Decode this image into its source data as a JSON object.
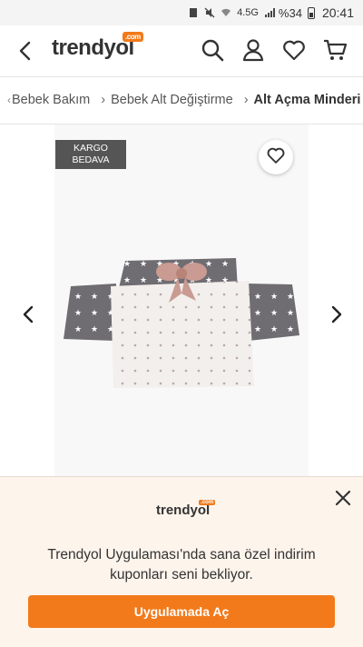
{
  "status_bar": {
    "network": "4.5G",
    "battery": "%34",
    "time": "20:41"
  },
  "header": {
    "logo_text": "trendyol",
    "logo_badge": ".com"
  },
  "breadcrumb": {
    "items": [
      "Bebek Bakım",
      "Bebek Alt Değiştirme",
      "Alt Açma Minderi"
    ]
  },
  "gallery": {
    "badge_line1": "KARGO",
    "badge_line2": "BEDAVA"
  },
  "app_banner": {
    "logo_text": "trendyol",
    "logo_badge": ".com",
    "message": "Trendyol Uygulaması'nda sana özel indirim kuponları seni bekliyor.",
    "button_label": "Uygulamada Aç"
  },
  "colors": {
    "brand": "#f27a1a",
    "banner_bg": "#fdf4ec",
    "badge_bg": "#555555"
  }
}
